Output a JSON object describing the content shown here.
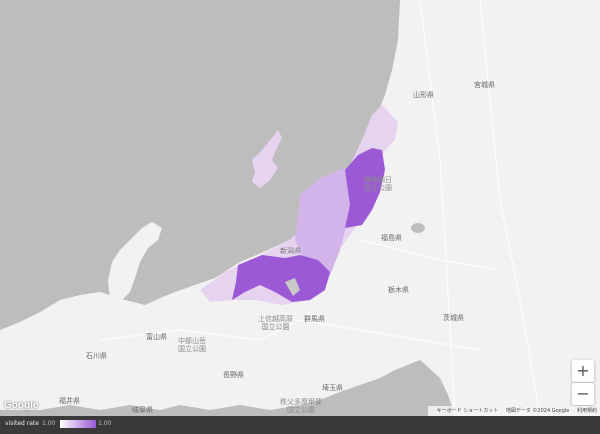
{
  "map": {
    "prefecture_labels": {
      "yamagata": "山形県",
      "miyagi": "宮城県",
      "fukushima": "福島県",
      "tochigi": "栃木県",
      "ibaraki": "茨城県",
      "gunma": "群馬県",
      "saitama": "埼玉県",
      "nagano": "長野県",
      "toyama": "富山県",
      "ishikawa": "石川県",
      "fukui": "福井県",
      "gifu": "岐阜県",
      "niigata": "新潟県"
    },
    "park_labels": {
      "bandai": "磐梯朝日\n国立公園",
      "joshinetsu": "上信越高原\n国立公園",
      "chubu": "中部山岳\n国立公園",
      "chichibu": "秩父多摩甲斐\n国立公園"
    },
    "colors": {
      "background": "#bdbdbd",
      "land": "#f2f2f2",
      "low": "#e6d3f0",
      "mid": "#d2b3ea",
      "high": "#9b59d6"
    }
  },
  "controls": {
    "zoom_in": "+",
    "zoom_out": "−"
  },
  "attribution": {
    "logo": "Google",
    "keyboard": "キーボード ショートカット",
    "mapdata": "地図データ ©2024 Google",
    "terms": "利用規約"
  },
  "legend": {
    "title": "visited rate",
    "min": "1.00",
    "max": "1.00"
  }
}
